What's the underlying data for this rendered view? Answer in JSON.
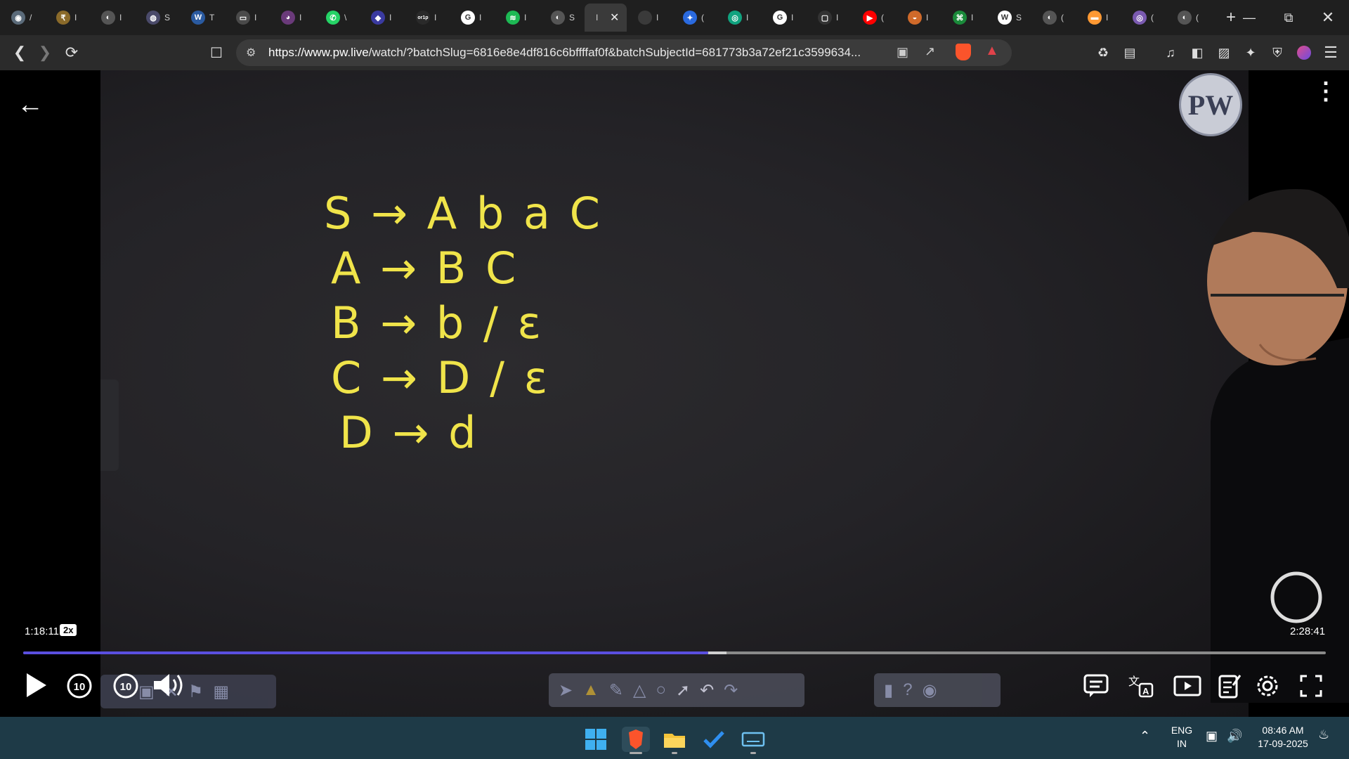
{
  "browser": {
    "tabs": [
      {
        "name": "tab-1",
        "title": "/",
        "color": "#5b6b7a",
        "glyph": "◉"
      },
      {
        "name": "tab-2",
        "title": "I",
        "color": "#8a6a2a",
        "glyph": "₹"
      },
      {
        "name": "tab-3",
        "title": "I",
        "color": "#555",
        "glyph": "◐"
      },
      {
        "name": "tab-4",
        "title": "S",
        "color": "#4a4a6a",
        "glyph": "◍"
      },
      {
        "name": "tab-5",
        "title": "T",
        "color": "#2a5aa0",
        "glyph": "W"
      },
      {
        "name": "tab-6",
        "title": "I",
        "color": "#4a4a4a",
        "glyph": "▭"
      },
      {
        "name": "tab-7",
        "title": "I",
        "color": "#6a3a7a",
        "glyph": "◕"
      },
      {
        "name": "tab-8",
        "title": "\\",
        "color": "#25d366",
        "glyph": "✆"
      },
      {
        "name": "tab-9",
        "title": "I",
        "color": "#3a3aa0",
        "glyph": "◆"
      },
      {
        "name": "tab-10",
        "title": "I",
        "color": "#2a2a2a",
        "glyph": "or1p"
      },
      {
        "name": "tab-11",
        "title": "I",
        "color": "#ffffff",
        "glyph": "G"
      },
      {
        "name": "tab-12",
        "title": "I",
        "color": "#1db954",
        "glyph": "≋"
      },
      {
        "name": "tab-13",
        "title": "S",
        "color": "#555",
        "glyph": "◐"
      },
      {
        "name": "tab-14",
        "title": "I",
        "color": "#3a3a3a",
        "glyph": ""
      },
      {
        "name": "tab-15",
        "title": "(",
        "color": "#2a6adf",
        "glyph": "✦"
      },
      {
        "name": "tab-16",
        "title": "I",
        "color": "#10a37f",
        "glyph": "◎"
      },
      {
        "name": "tab-17",
        "title": "I",
        "color": "#ffffff",
        "glyph": "G"
      },
      {
        "name": "tab-18",
        "title": "I",
        "color": "#333",
        "glyph": "▢"
      },
      {
        "name": "tab-19",
        "title": "(",
        "color": "#ff0000",
        "glyph": "▶"
      },
      {
        "name": "tab-20",
        "title": "I",
        "color": "#d06a2a",
        "glyph": "◒"
      },
      {
        "name": "tab-21",
        "title": "I",
        "color": "#1a8a3a",
        "glyph": "⌘"
      },
      {
        "name": "tab-22",
        "title": "S",
        "color": "#ffffff",
        "glyph": "W"
      },
      {
        "name": "tab-23",
        "title": "(",
        "color": "#555",
        "glyph": "◐"
      },
      {
        "name": "tab-24",
        "title": "I",
        "color": "#ff9933",
        "glyph": "▬"
      },
      {
        "name": "tab-25",
        "title": "(",
        "color": "#7a5ab0",
        "glyph": "◎"
      },
      {
        "name": "tab-26",
        "title": "(",
        "color": "#555",
        "glyph": "◐"
      }
    ],
    "active_tab_title": "I",
    "url_host": "https://www.pw.live",
    "url_path": "/watch/?batchSlug=6816e8e4df816c6bffffaf0f&batchSubjectId=681773b3a72ef21c3599634..."
  },
  "lecture": {
    "board_lines": [
      "S → A b a C",
      "A → B C",
      "B → b / ε",
      "C → D / ε",
      "D → d"
    ]
  },
  "player": {
    "time_current": "1:18:11",
    "speed_badge": "2x",
    "time_total": "2:28:41",
    "progress_fraction": 0.526,
    "buffer_fraction": 0.54,
    "rewind_label": "10",
    "forward_label": "10",
    "logo_text": "PW",
    "accent_color": "#5a4fe0"
  },
  "taskbar": {
    "lang_top": "ENG",
    "lang_bottom": "IN",
    "time": "08:46 AM",
    "date": "17-09-2025",
    "bg_color": "#1e3a47"
  }
}
